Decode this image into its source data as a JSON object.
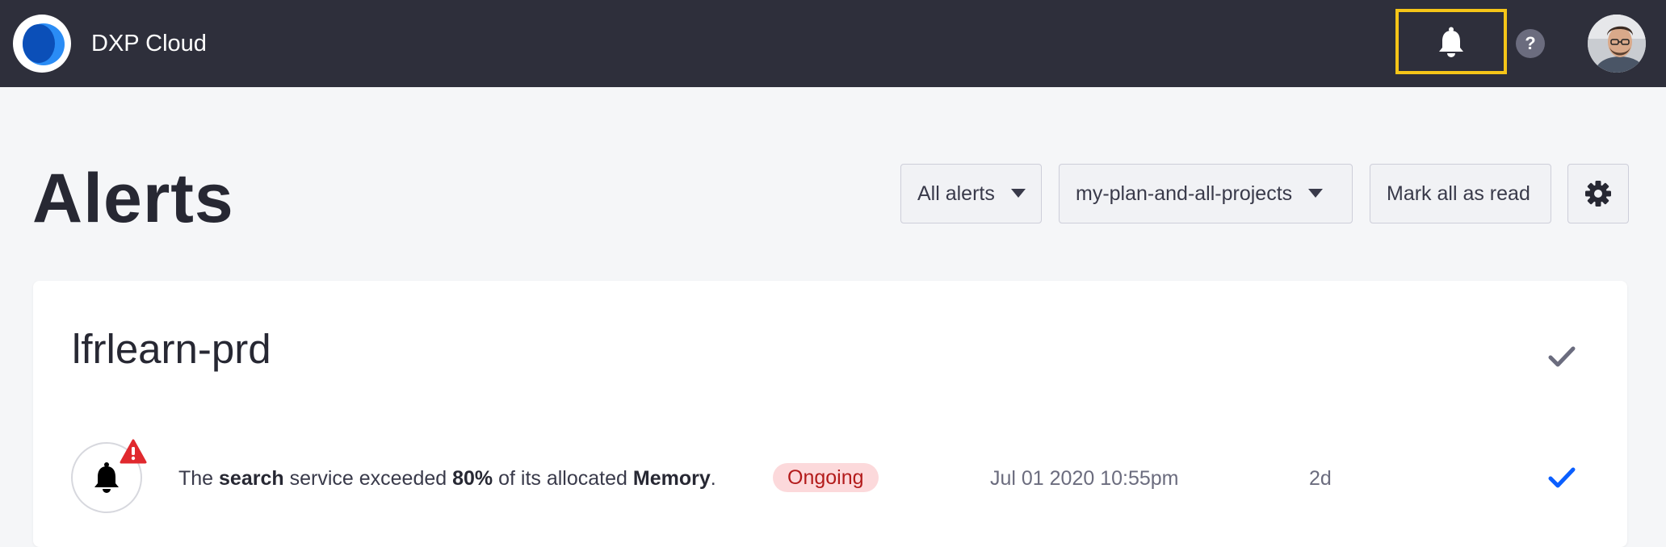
{
  "app": {
    "title": "DXP Cloud"
  },
  "navbar": {
    "notifications_icon": "bell-icon",
    "help_label": "?",
    "avatar_icon": "user-avatar"
  },
  "page": {
    "title": "Alerts"
  },
  "toolbar": {
    "filter_label": "All alerts",
    "scope_label": "my-plan-and-all-projects",
    "mark_read_label": "Mark all as read",
    "settings_icon": "gear-icon"
  },
  "project": {
    "name": "lfrlearn-prd",
    "alerts": [
      {
        "text_prefix": "The ",
        "service": "search",
        "text_middle": " service exceeded ",
        "percent": "80%",
        "text_middle2": " of its allocated ",
        "resource": "Memory",
        "text_suffix": ".",
        "status": "Ongoing",
        "timestamp": "Jul 01 2020 10:55pm",
        "age": "2d"
      }
    ]
  },
  "colors": {
    "navbar_bg": "#2e2f3b",
    "highlight_border": "#f5c518",
    "accent_blue": "#0b5fff",
    "status_ongoing_bg": "#fcd9db",
    "status_ongoing_text": "#b31b1b",
    "warning_red": "#e0292e"
  }
}
